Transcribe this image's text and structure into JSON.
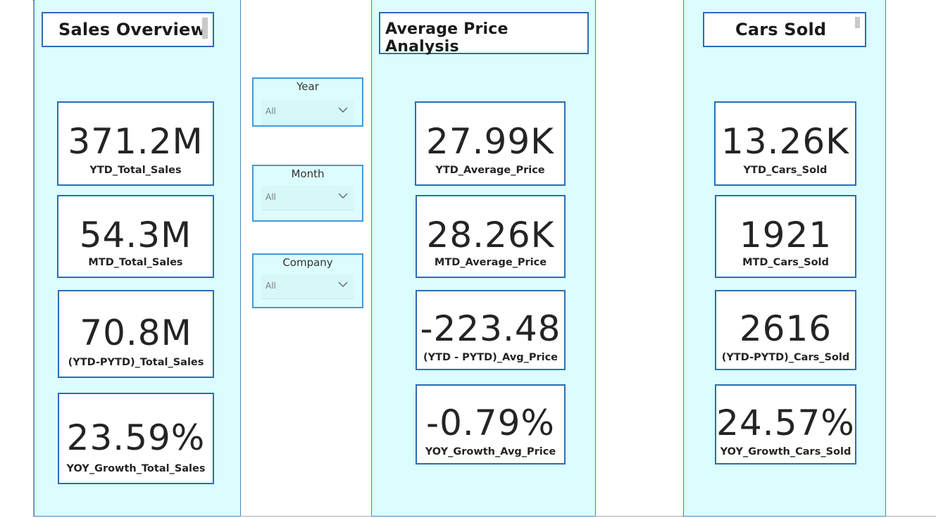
{
  "panels": {
    "sales": {
      "title": "Sales Overview",
      "cards": [
        {
          "value": "371.2M",
          "label": "YTD_Total_Sales"
        },
        {
          "value": "54.3M",
          "label": "MTD_Total_Sales"
        },
        {
          "value": "70.8M",
          "label": "(YTD-PYTD)_Total_Sales"
        },
        {
          "value": "23.59%",
          "label": "YOY_Growth_Total_Sales"
        }
      ]
    },
    "price": {
      "title": "Average Price Analysis",
      "cards": [
        {
          "value": "27.99K",
          "label": "YTD_Average_Price"
        },
        {
          "value": "28.26K",
          "label": "MTD_Average_Price"
        },
        {
          "value": "-223.48",
          "label": "(YTD - PYTD)_Avg_Price"
        },
        {
          "value": "-0.79%",
          "label": "YOY_Growth_Avg_Price"
        }
      ]
    },
    "cars": {
      "title": "Cars Sold",
      "cards": [
        {
          "value": "13.26K",
          "label": "YTD_Cars_Sold"
        },
        {
          "value": "1921",
          "label": "MTD_Cars_Sold"
        },
        {
          "value": "2616",
          "label": "(YTD-PYTD)_Cars_Sold"
        },
        {
          "value": "24.57%",
          "label": "YOY_Growth_Cars_Sold"
        }
      ]
    }
  },
  "slicers": [
    {
      "title": "Year",
      "value": "All",
      "icon": "chevron-down-icon"
    },
    {
      "title": "Month",
      "value": "All",
      "icon": "chevron-down-icon"
    },
    {
      "title": "Company",
      "value": "All",
      "icon": "chevron-down-icon"
    }
  ],
  "colors": {
    "panel_bg": "#dcfdfd",
    "card_border": "#2a6db5",
    "slicer_border": "#3f9be0"
  }
}
